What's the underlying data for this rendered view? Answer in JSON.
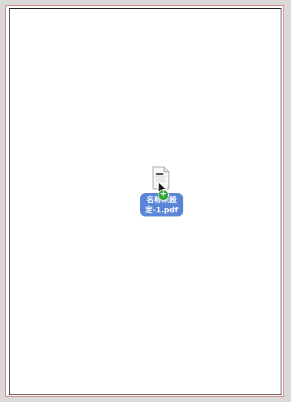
{
  "canvas": {
    "background_color": "#ffffff",
    "outer_border_color": "#d04545",
    "inner_border_color": "#000000"
  },
  "drag_item": {
    "file_name": "名称未設\n定-1.pdf",
    "file_icon": "pdf-document-icon",
    "badge": "+",
    "badge_icon": "plus-badge-icon",
    "badge_color": "#2fa32f",
    "label_color": "#5b86d8",
    "cursor_icon": "arrow-cursor-icon"
  }
}
